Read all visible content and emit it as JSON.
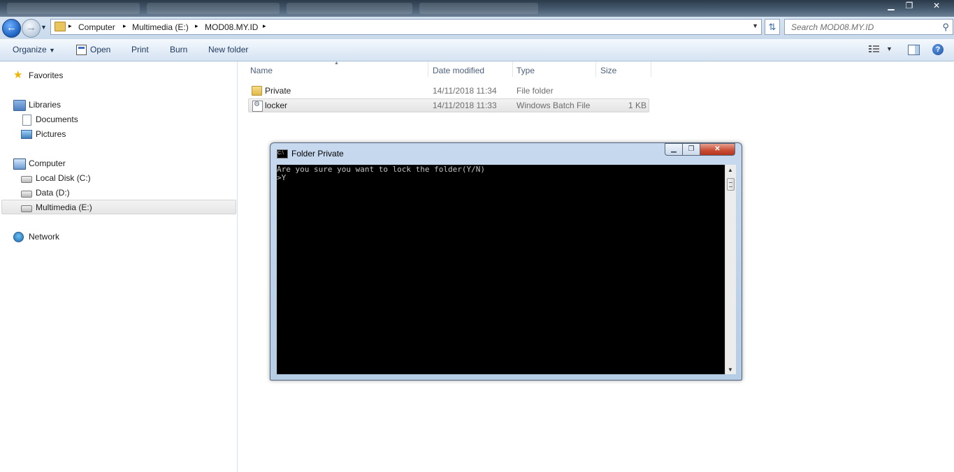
{
  "window": {
    "controls": {
      "minimize": "▁",
      "restore": "❐",
      "close": "✕"
    }
  },
  "address_bar": {
    "breadcrumbs": [
      "Computer",
      "Multimedia (E:)",
      "MOD08.MY.ID"
    ],
    "separator": "▸"
  },
  "search": {
    "placeholder": "Search MOD08.MY.ID"
  },
  "toolbar": {
    "organize": "Organize",
    "open": "Open",
    "print": "Print",
    "burn": "Burn",
    "new_folder": "New folder"
  },
  "nav_pane": {
    "favorites": "Favorites",
    "libraries": "Libraries",
    "documents": "Documents",
    "pictures": "Pictures",
    "computer": "Computer",
    "local_disk": "Local Disk (C:)",
    "data": "Data (D:)",
    "multimedia": "Multimedia (E:)",
    "network": "Network"
  },
  "file_list": {
    "columns": {
      "name": "Name",
      "date": "Date modified",
      "type": "Type",
      "size": "Size"
    },
    "rows": [
      {
        "name": "Private",
        "date": "14/11/2018 11:34",
        "type": "File folder",
        "size": "",
        "icon": "folder-icon"
      },
      {
        "name": "locker",
        "date": "14/11/2018 11:33",
        "type": "Windows Batch File",
        "size": "1 KB",
        "icon": "batch-file-icon"
      }
    ]
  },
  "console_window": {
    "title": "Folder Private",
    "lines": [
      "Are you sure you want to lock the folder(Y/N)",
      ">Y"
    ]
  }
}
